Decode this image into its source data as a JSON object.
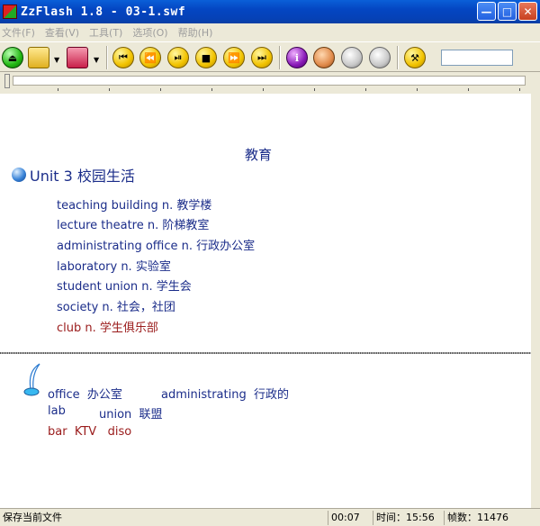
{
  "window": {
    "title": "ZzFlash 1.8  - 03-1.swf"
  },
  "menu": [
    {
      "label": "文件(F)"
    },
    {
      "label": "查看(V)"
    },
    {
      "label": "工具(T)"
    },
    {
      "label": "选项(O)"
    },
    {
      "label": "帮助(H)"
    }
  ],
  "toolbar": {
    "info_glyph": "i",
    "icons": [
      "eject-icon",
      "open-folder-icon",
      "save-disk-icon",
      "first-frame-icon",
      "rewind-icon",
      "play-pause-icon",
      "stop-icon",
      "fast-forward-icon",
      "last-frame-icon",
      "info-icon",
      "face-icon",
      "capture-icon",
      "tools-icon",
      "hammer-icon"
    ]
  },
  "content": {
    "heading": "教育",
    "unit_title": "Unit 3 校园生活",
    "vocab": [
      {
        "text": "teaching building   n. 教学楼",
        "color": "#1b2d8a"
      },
      {
        "text": "lecture theatre  n.  阶梯教室",
        "color": "#1b2d8a"
      },
      {
        "text": "administrating office  n. 行政办公室",
        "color": "#1b2d8a"
      },
      {
        "text": "laboratory  n. 实验室",
        "color": "#1b2d8a"
      },
      {
        "text": "student union  n. 学生会",
        "color": "#1b2d8a"
      },
      {
        "text": "society  n. 社会，社团",
        "color": "#1b2d8a"
      },
      {
        "text": "club  n. 学生俱乐部",
        "color": "#9a1b1b"
      }
    ],
    "lower": {
      "office": "office  办公室",
      "administrating": "administrating  行政的",
      "lab": "lab",
      "union": "union  联盟",
      "bar": "bar  KTV   diso"
    }
  },
  "status": {
    "message": "保存当前文件",
    "position": "00:07",
    "time": "时间：15:56",
    "frames": "帧数：11476"
  },
  "colors": {
    "text_blue": "#1b2d8a",
    "text_red": "#9a1b1b"
  }
}
